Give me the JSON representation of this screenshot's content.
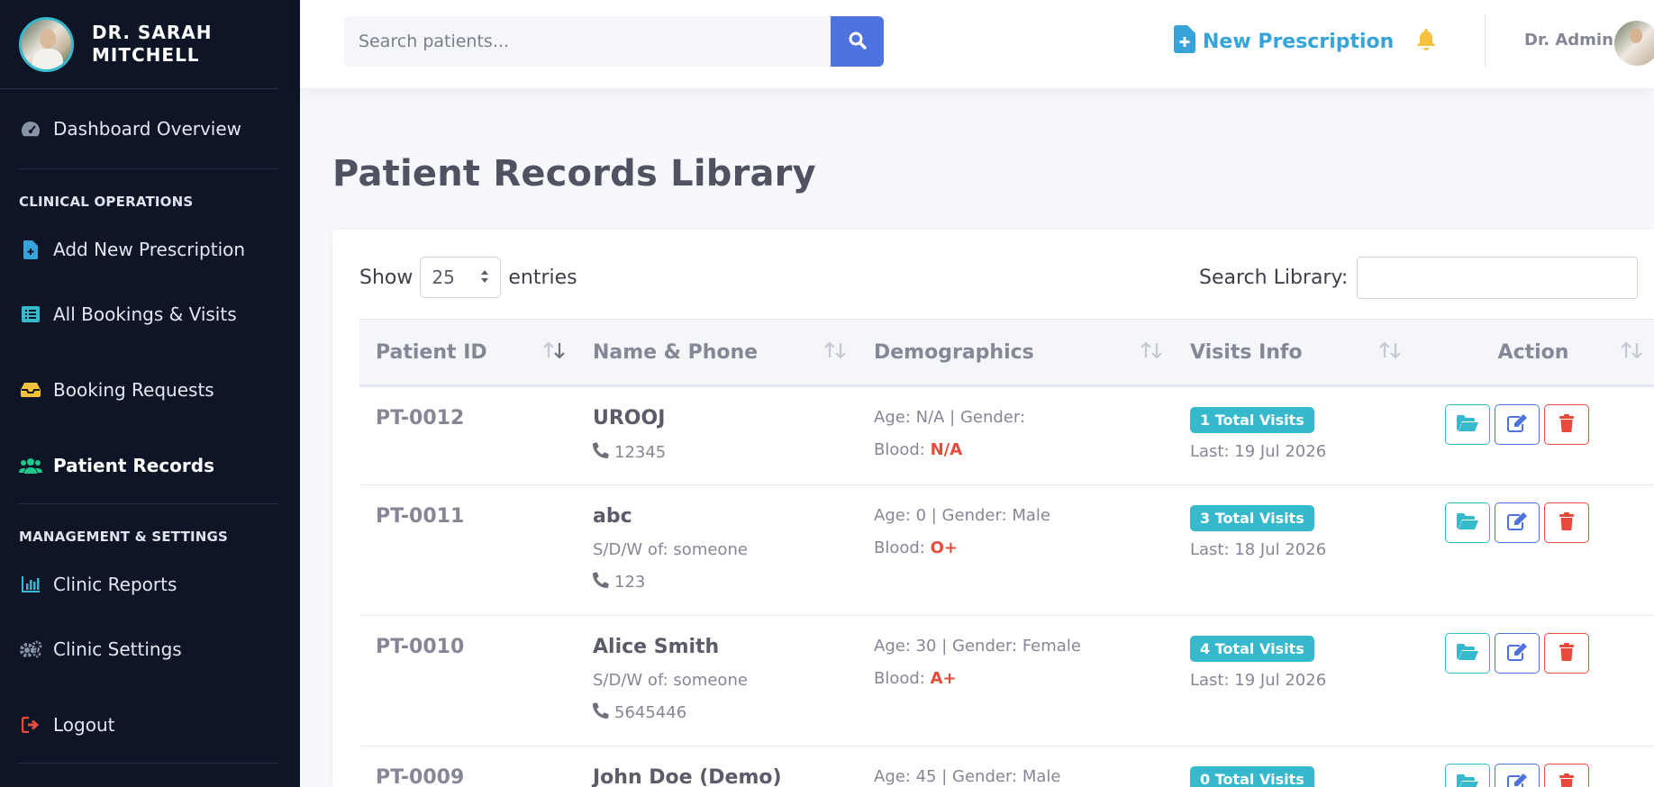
{
  "sidebar": {
    "brand_name": "DR. SARAH\nMITCHELL",
    "dashboard": "Dashboard Overview",
    "section_clinical": "CLINICAL OPERATIONS",
    "add_prescription": "Add New Prescription",
    "all_bookings": "All Bookings & Visits",
    "booking_requests": "Booking Requests",
    "patient_records": "Patient Records",
    "section_management": "MANAGEMENT & SETTINGS",
    "clinic_reports": "Clinic Reports",
    "clinic_settings": "Clinic Settings",
    "logout": "Logout"
  },
  "topbar": {
    "search_placeholder": "Search patients...",
    "new_prescription": "New Prescription",
    "user_name": "Dr. Admin"
  },
  "page": {
    "title": "Patient Records Library",
    "show_label": "Show",
    "entries_value": "25",
    "entries_label": "entries",
    "search_label": "Search Library:"
  },
  "table": {
    "headers": [
      "Patient ID",
      "Name & Phone",
      "Demographics",
      "Visits Info",
      "Action"
    ],
    "rows": [
      {
        "id": "PT-0012",
        "name": "UROOJ",
        "guardian": "",
        "phone": "12345",
        "demo": "Age: N/A | Gender:",
        "blood_label": "Blood:",
        "blood": "N/A",
        "visits": "1 Total Visits",
        "last": "Last: 19 Jul 2026"
      },
      {
        "id": "PT-0011",
        "name": "abc",
        "guardian": "S/D/W of: someone",
        "phone": "123",
        "demo": "Age: 0 | Gender: Male",
        "blood_label": "Blood:",
        "blood": "O+",
        "visits": "3 Total Visits",
        "last": "Last: 18 Jul 2026"
      },
      {
        "id": "PT-0010",
        "name": "Alice Smith",
        "guardian": "S/D/W of: someone",
        "phone": "5645446",
        "demo": "Age: 30 | Gender: Female",
        "blood_label": "Blood:",
        "blood": "A+",
        "visits": "4 Total Visits",
        "last": "Last: 19 Jul 2026"
      },
      {
        "id": "PT-0009",
        "name": "John Doe (Demo)",
        "guardian": "",
        "phone": "",
        "demo": "Age: 45 | Gender: Male",
        "blood_label": "",
        "blood": "",
        "visits": "0 Total Visits",
        "last": ""
      }
    ]
  },
  "colors": {
    "sidebar_bg": "#0d1526",
    "primary": "#4e73df",
    "info": "#36b9cc",
    "danger": "#e74a3b",
    "warning": "#f6c23e",
    "success": "#1cc88a"
  },
  "icons": [
    "tachometer-icon",
    "file-plus-icon",
    "list-icon",
    "inbox-icon",
    "users-icon",
    "chart-bar-icon",
    "cogs-icon",
    "sign-out-icon",
    "search-icon",
    "bell-icon",
    "phone-icon",
    "folder-open-icon",
    "edit-icon",
    "trash-icon",
    "sort-icon"
  ]
}
